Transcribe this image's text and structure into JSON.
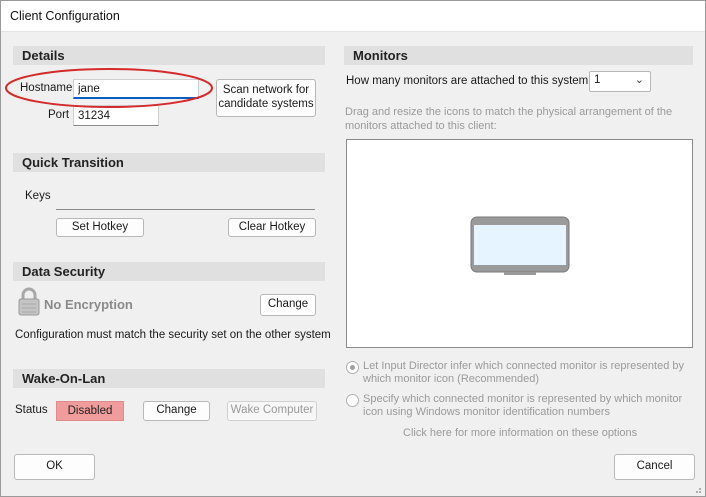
{
  "window": {
    "title": "Client Configuration"
  },
  "details": {
    "header": "Details",
    "hostname_label": "Hostname",
    "hostname_value": "jane",
    "port_label": "Port",
    "port_value": "31234",
    "scan_button": "Scan network for candidate systems"
  },
  "quick_transition": {
    "header": "Quick Transition",
    "keys_label": "Keys",
    "keys_value": "",
    "set_hotkey": "Set Hotkey",
    "clear_hotkey": "Clear Hotkey"
  },
  "data_security": {
    "header": "Data Security",
    "encryption_status": "No Encryption",
    "change_button": "Change",
    "note": "Configuration must match the security set on the other system"
  },
  "wake_on_lan": {
    "header": "Wake-On-Lan",
    "status_label": "Status",
    "status_value": "Disabled",
    "change_button": "Change",
    "wake_button": "Wake Computer"
  },
  "monitors": {
    "header": "Monitors",
    "count_question": "How many monitors are attached to this system",
    "count_value": "1",
    "drag_hint": "Drag and resize the icons to match the physical arrangement of the monitors attached to this client:",
    "option_infer": "Let Input Director infer which connected monitor is represented by which monitor icon (Recommended)",
    "option_specify": "Specify which connected monitor is represented by which monitor icon using Windows monitor identification numbers",
    "info_link": "Click here for more information on these options"
  },
  "footer": {
    "ok": "OK",
    "cancel": "Cancel"
  },
  "colors": {
    "highlight_ellipse": "#d42a2a",
    "status_disabled": "#f19c9c",
    "focus_underline": "#0b5fc2"
  }
}
